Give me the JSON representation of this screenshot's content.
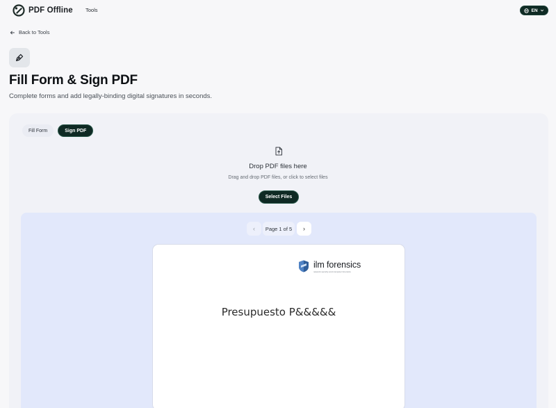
{
  "header": {
    "brand_name": "PDF Offline",
    "nav_tools": "Tools",
    "language": "EN"
  },
  "back_link": "Back to Tools",
  "page": {
    "title": "Fill Form & Sign PDF",
    "subtitle": "Complete forms and add legally-binding digital signatures in seconds."
  },
  "tabs": [
    {
      "label": "Fill Form",
      "active": false
    },
    {
      "label": "Sign PDF",
      "active": true
    }
  ],
  "dropzone": {
    "title": "Drop PDF files here",
    "hint": "Drag and drop PDF files, or click to select files",
    "button": "Select Files"
  },
  "viewer": {
    "page_indicator": "Page 1 of 5",
    "current_page": 1,
    "total_pages": 5,
    "document": {
      "company_name": "ilm forensics",
      "company_tagline": "network security and computer forensics",
      "heading": "Presupuesto P&&&&&"
    }
  },
  "colors": {
    "accent": "#0f2a24",
    "background": "#f7f7f9",
    "viewer_background": "#e2e8fb"
  }
}
